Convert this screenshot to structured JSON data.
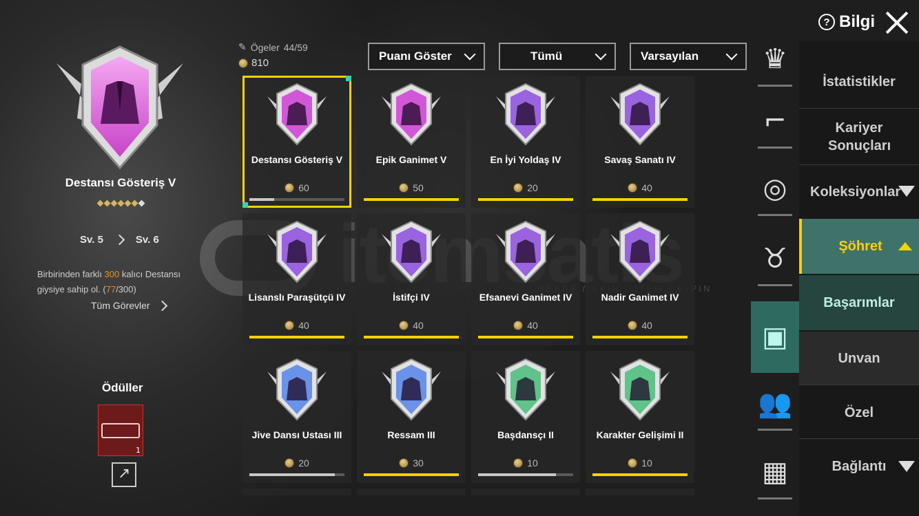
{
  "header": {
    "info_label": "Bilgi"
  },
  "left_panel": {
    "title": "Destansı Gösteriş V",
    "stars_total": 7,
    "level_current": "Sv. 5",
    "level_next": "Sv. 6",
    "desc_prefix": "Birbirinden farklı ",
    "desc_highlight": "300",
    "desc_mid": " kalıcı Destansı giysiye sahip ol. (",
    "desc_progress": "77",
    "desc_suffix": "/300)",
    "all_tasks": "Tüm Görevler",
    "rewards_title": "Ödüller",
    "reward_count": "1"
  },
  "summary": {
    "items_label": "Ögeler",
    "items_value": "44/59",
    "points": "810"
  },
  "filters": [
    {
      "label": "Puanı Göster"
    },
    {
      "label": "Tümü"
    },
    {
      "label": "Varsayılan"
    }
  ],
  "cards": [
    {
      "name": "Destansı Gösteriş V",
      "points": "60",
      "progress": 0.26,
      "color": "#d257d8",
      "fill": "grey",
      "selected": true,
      "icon": "jacket-icon"
    },
    {
      "name": "Epik Ganimet V",
      "points": "50",
      "progress": 1,
      "color": "#d257d8",
      "fill": "yellow",
      "icon": "vest-icon"
    },
    {
      "name": "En İyi Yoldaş IV",
      "points": "20",
      "progress": 1,
      "color": "#9a63e0",
      "fill": "yellow",
      "icon": "eagle-icon"
    },
    {
      "name": "Savaş Sanatı IV",
      "points": "40",
      "progress": 1,
      "color": "#9a63e0",
      "fill": "yellow",
      "icon": "claw-icon"
    },
    {
      "name": "Lisanslı Paraşütçü IV",
      "points": "40",
      "progress": 1,
      "color": "#9a63e0",
      "fill": "yellow",
      "icon": "parachute-icon"
    },
    {
      "name": "İstifçi IV",
      "points": "40",
      "progress": 1,
      "color": "#9a63e0",
      "fill": "yellow",
      "icon": "locker-icon"
    },
    {
      "name": "Efsanevi Ganimet IV",
      "points": "40",
      "progress": 1,
      "color": "#9a63e0",
      "fill": "yellow",
      "icon": "armor-icon"
    },
    {
      "name": "Nadir Ganimet IV",
      "points": "40",
      "progress": 1,
      "color": "#9a63e0",
      "fill": "yellow",
      "icon": "coat-icon"
    },
    {
      "name": "Jive Dansı Ustası III",
      "points": "20",
      "progress": 0.9,
      "color": "#6a92e8",
      "fill": "grey",
      "icon": "dancer-icon"
    },
    {
      "name": "Ressam III",
      "points": "30",
      "progress": 1,
      "color": "#6a92e8",
      "fill": "yellow",
      "icon": "crosshair-gun-icon"
    },
    {
      "name": "Başdansçı II",
      "points": "10",
      "progress": 0.82,
      "color": "#5fc38a",
      "fill": "grey",
      "icon": "dancer-icon"
    },
    {
      "name": "Karakter Gelişimi II",
      "points": "10",
      "progress": 1,
      "color": "#5fc38a",
      "fill": "yellow",
      "icon": "character-icon"
    }
  ],
  "categories": [
    {
      "icon": "crown-icon"
    },
    {
      "icon": "pistol-icon"
    },
    {
      "icon": "medal-icon"
    },
    {
      "icon": "muscle-icon"
    },
    {
      "icon": "box-icon",
      "active": true
    },
    {
      "icon": "friends-icon"
    },
    {
      "icon": "grid-icon"
    }
  ],
  "menu": {
    "stats": "İstatistikler",
    "career": "Kariyer Sonuçları",
    "collections": "Koleksiyonlar",
    "fame": "Şöhret",
    "achievements": "Başarımlar",
    "title": "Unvan",
    "special": "Özel",
    "connection": "Bağlantı"
  },
  "watermark": {
    "brand": "itemsatis",
    "sub": "HESAP / SKIN / ITEM / E-PIN .com"
  }
}
